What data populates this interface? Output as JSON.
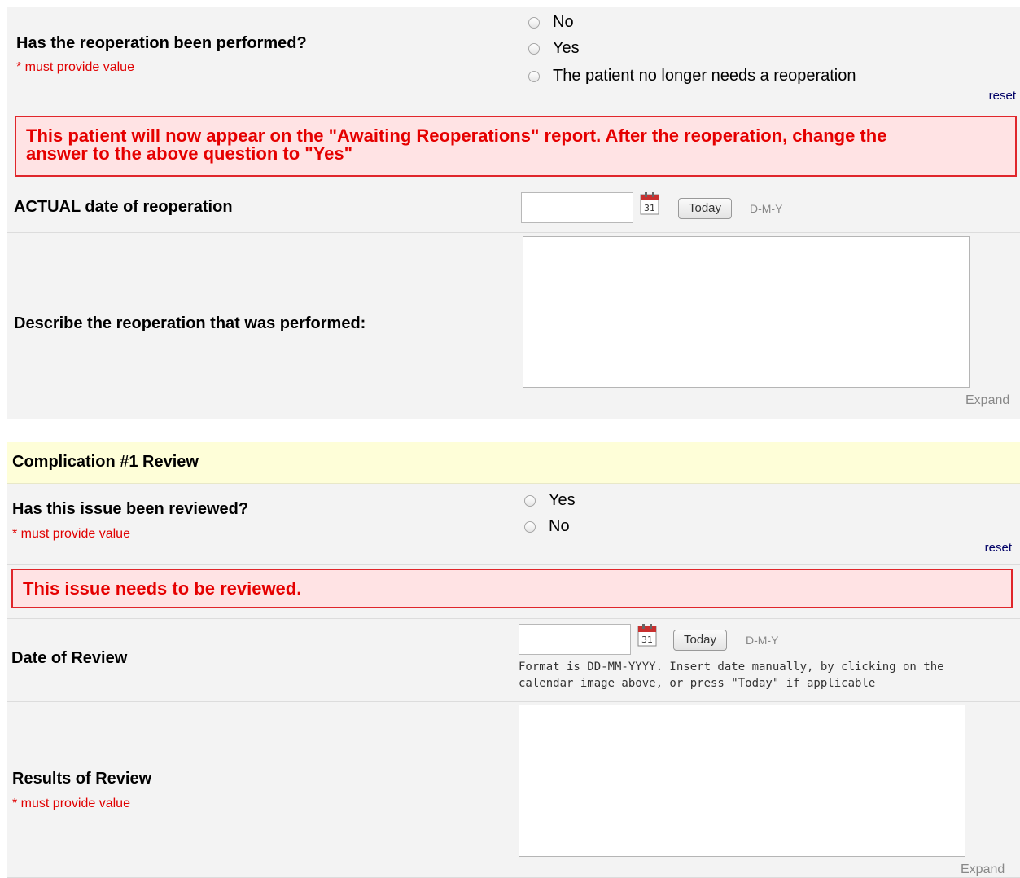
{
  "q1": {
    "label": "Has the reoperation been performed?",
    "required": "* must provide value",
    "options": [
      "No",
      "Yes",
      "The patient no longer needs a reoperation"
    ],
    "reset": "reset"
  },
  "alert1": {
    "line1": "This patient will now appear on the \"Awaiting Reoperations\" report. After the reoperation, change the",
    "line2": "answer to the above question to \"Yes\""
  },
  "actual_date": {
    "label": "ACTUAL date of reoperation",
    "today": "Today",
    "format": "D-M-Y"
  },
  "describe": {
    "label": "Describe the reoperation that was performed:",
    "expand": "Expand"
  },
  "section": {
    "title": "Complication #1 Review"
  },
  "q2": {
    "label": "Has this issue been reviewed?",
    "required": "* must provide value",
    "options": [
      "Yes",
      "No"
    ],
    "reset": "reset"
  },
  "alert2": {
    "text": "This issue needs to be reviewed."
  },
  "review_date": {
    "label": "Date of Review",
    "today": "Today",
    "format": "D-M-Y",
    "hint_line1": "Format is DD-MM-YYYY. Insert date manually, by clicking on the",
    "hint_line2": "calendar image above, or press \"Today\" if applicable"
  },
  "results": {
    "label": "Results of Review",
    "required": "* must provide value",
    "expand": "Expand"
  },
  "colors": {
    "alert_border": "#e0262b",
    "alert_bg": "#ffe3e4",
    "alert_text": "#e50000",
    "section_bg": "#fefed8"
  },
  "icons": [
    "radio-button-icon",
    "calendar-icon"
  ]
}
